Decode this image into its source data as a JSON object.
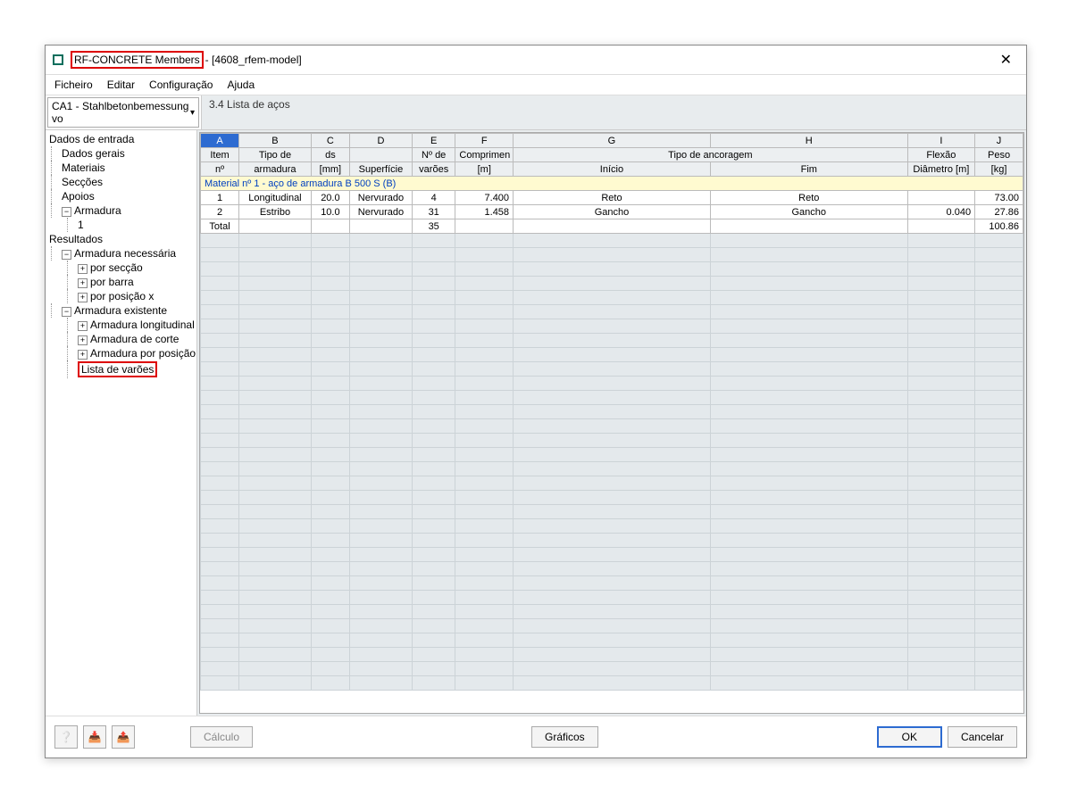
{
  "title": {
    "app": "RF-CONCRETE Members",
    "rest": " - [4608_rfem-model]"
  },
  "menu": {
    "file": "Ficheiro",
    "edit": "Editar",
    "config": "Configuração",
    "help": "Ajuda"
  },
  "case_select": "CA1 - Stahlbetonbemessung vo",
  "section_title": "3.4 Lista de aços",
  "tree": {
    "input_header": "Dados de entrada",
    "dados_gerais": "Dados gerais",
    "materiais": "Materiais",
    "seccoes": "Secções",
    "apoios": "Apoios",
    "armadura": "Armadura",
    "armadura_1": "1",
    "results_header": "Resultados",
    "arm_nec": "Armadura necessária",
    "por_seccao": "por secção",
    "por_barra": "por barra",
    "por_posx": "por posição x",
    "arm_exist": "Armadura existente",
    "arm_long": "Armadura longitudinal",
    "arm_corte": "Armadura de corte",
    "arm_posx": "Armadura por posição x",
    "lista_varoes": "Lista de varões"
  },
  "columns": {
    "letters": [
      "A",
      "B",
      "C",
      "D",
      "E",
      "F",
      "G",
      "H",
      "I",
      "J"
    ],
    "r1": {
      "A": "Item",
      "B": "Tipo de",
      "C": "ds",
      "D": "",
      "E": "Nº de",
      "F": "Comprimen",
      "GH": "Tipo de ancoragem",
      "I": "Flexão",
      "J": "Peso"
    },
    "r2": {
      "A": "nº",
      "B": "armadura",
      "C": "[mm]",
      "D": "Superfície",
      "E": "varões",
      "F": "[m]",
      "G": "Início",
      "H": "Fim",
      "I": "Diâmetro [m]",
      "J": "[kg]"
    }
  },
  "material_row": "Material nº 1  -  aço de armadura B 500 S (B)",
  "rows": [
    {
      "A": "1",
      "B": "Longitudinal",
      "C": "20.0",
      "D": "Nervurado",
      "E": "4",
      "F": "7.400",
      "G": "Reto",
      "H": "Reto",
      "I": "",
      "J": "73.00"
    },
    {
      "A": "2",
      "B": "Estribo",
      "C": "10.0",
      "D": "Nervurado",
      "E": "31",
      "F": "1.458",
      "G": "Gancho",
      "H": "Gancho",
      "I": "0.040",
      "J": "27.86"
    }
  ],
  "total": {
    "label": "Total",
    "E": "35",
    "J": "100.86"
  },
  "footer": {
    "calc": "Cálculo",
    "graphs": "Gráficos",
    "ok": "OK",
    "cancel": "Cancelar"
  }
}
